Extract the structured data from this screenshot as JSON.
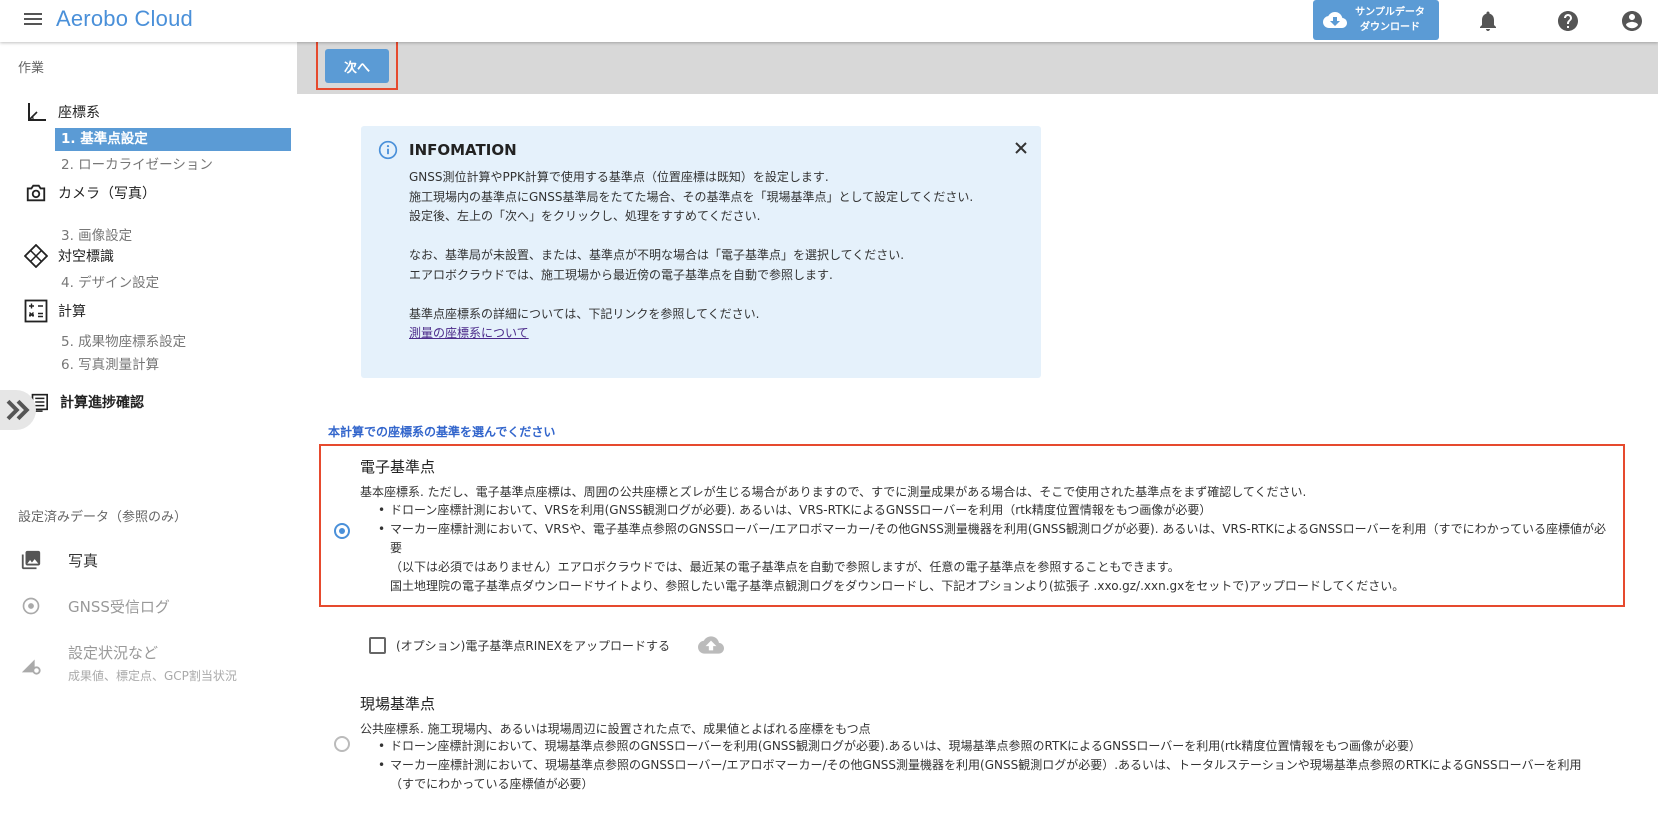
{
  "header": {
    "title": "Aerobo Cloud",
    "sample_btn_line1": "サンプルデータ",
    "sample_btn_line2": "ダウンロード"
  },
  "sidebar": {
    "work_head": "作業",
    "coord_cat": "座標系",
    "item_base_point": "1. 基準点設定",
    "item_localization": "2. ローカライゼーション",
    "camera_cat": "カメラ（写真）",
    "item_image_settings": "3. 画像設定",
    "marker_cat": "対空標識",
    "item_design": "4. デザイン設定",
    "calc_cat": "計算",
    "item_result_coord": "5. 成果物座標系設定",
    "item_photo_survey": "6. 写真測量計算",
    "progress_cat": "計算進捗確認",
    "data_head": "設定済みデータ（参照のみ）",
    "photos": "写真",
    "gnss_log": "GNSS受信ログ",
    "settings_status": "設定状況など",
    "settings_status_sub": "成果値、標定点、GCP割当状況"
  },
  "toolbar": {
    "next_label": "次へ"
  },
  "info": {
    "title": "INFOMATION",
    "line1": "GNSS測位計算やPPK計算で使用する基準点（位置座標は既知）を設定します.",
    "line2": "施工現場内の基準点にGNSS基準局をたてた場合、その基準点を「現場基準点」として設定してください.",
    "line3": "設定後、左上の「次へ」をクリックし、処理をすすめてください.",
    "line4": "なお、基準局が未設置、または、基準点が不明な場合は「電子基準点」を選択してください.",
    "line5": "エアロボクラウドでは、施工現場から最近傍の電子基準点を自動で参照します.",
    "line6": "基準点座標系の詳細については、下記リンクを参照してください.",
    "link": "測量の座標系について"
  },
  "choose_label": "本計算での座標系の基準を選んでください",
  "options": {
    "electronic": {
      "title": "電子基準点",
      "desc": "基本座標系. ただし、電子基準点座標は、周囲の公共座標とズレが生じる場合がありますので、すでに測量成果がある場合は、そこで使用された基準点をまず確認してください.",
      "b1": "ドローン座標計測において、VRSを利用(GNSS観測ログが必要). あるいは、VRS-RTKによるGNSSローバーを利用（rtk精度位置情報をもつ画像が必要）",
      "b2": "マーカー座標計測において、VRSや、電子基準点参照のGNSSローバー/エアロボマーカー/その他GNSS測量機器を利用(GNSS観測ログが必要). あるいは、VRS-RTKによるGNSSローバーを利用（すでにわかっている座標値が必要",
      "b3": "（以下は必須ではありません）エアロボクラウドでは、最近某の電子基準点を自動で参照しますが、任意の電子基準点を参照することもできます。",
      "b4": "国土地理院の電子基準点ダウンロードサイトより、参照したい電子基準点観測ログをダウンロードし、下記オプションより(拡張子 .xxo.gz/.xxn.gxをセットで)アップロードしてください。",
      "selected": true
    },
    "upload_label": "(オプション)電子基準点RINEXをアップロードする",
    "site": {
      "title": "現場基準点",
      "desc": "公共座標系. 施工現場内、あるいは現場周辺に設置された点で、成果値とよばれる座標をもつ点",
      "b1": "ドローン座標計測において、現場基準点参照のGNSSローバーを利用(GNSS観測ログが必要).あるいは、現場基準点参照のRTKによるGNSSローバーを利用(rtk精度位置情報をもつ画像が必要）",
      "b2": "マーカー座標計測において、現場基準点参照のGNSSローバー/エアロボマーカー/その他GNSS測量機器を利用(GNSS観測ログが必要）.あるいは、トータルステーションや現場基準点参照のRTKによるGNSSローバーを利用",
      "b3": "（すでにわかっている座標値が必要）",
      "selected": false
    }
  },
  "colors": {
    "accent": "#5b9bd5",
    "highlight": "#e64a2e",
    "info_bg": "#e5f1fb"
  }
}
